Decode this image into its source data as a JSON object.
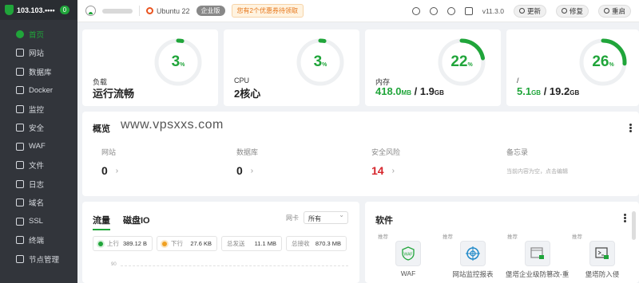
{
  "sidebar": {
    "ip": "103.103.••••",
    "badge": "0",
    "items": [
      {
        "label": "首页",
        "icon": "home-icon",
        "active": true
      },
      {
        "label": "网站",
        "icon": "globe-icon"
      },
      {
        "label": "数据库",
        "icon": "database-icon"
      },
      {
        "label": "Docker",
        "icon": "docker-icon"
      },
      {
        "label": "监控",
        "icon": "monitor-icon"
      },
      {
        "label": "安全",
        "icon": "shield-icon"
      },
      {
        "label": "WAF",
        "icon": "waf-icon"
      },
      {
        "label": "文件",
        "icon": "folder-icon"
      },
      {
        "label": "日志",
        "icon": "log-icon"
      },
      {
        "label": "域名",
        "icon": "domain-icon"
      },
      {
        "label": "SSL",
        "icon": "ssl-icon"
      },
      {
        "label": "终端",
        "icon": "terminal-icon"
      },
      {
        "label": "节点管理",
        "icon": "node-icon"
      }
    ]
  },
  "header": {
    "os": "Ubuntu 22",
    "edition": "企业版",
    "promo": "您有2个优惠券待领取",
    "version": "v11.3.0",
    "buttons": {
      "update": "更新",
      "repair": "修复",
      "restart": "重启"
    }
  },
  "stats": [
    {
      "label": "负载",
      "value": "运行流畅",
      "percent": 3,
      "unit": "%"
    },
    {
      "label": "CPU",
      "value": "2核心",
      "percent": 3,
      "unit": "%"
    },
    {
      "label": "内存",
      "used": "418.0",
      "used_unit": "MB",
      "total": "1.9",
      "total_unit": "GB",
      "percent": 22,
      "unit": "%"
    },
    {
      "label": "/",
      "used": "5.1",
      "used_unit": "GB",
      "total": "19.2",
      "total_unit": "GB",
      "percent": 26,
      "unit": "%"
    }
  ],
  "overview": {
    "title": "概览",
    "watermark": "www.vpsxxs.com",
    "items": [
      {
        "label": "网站",
        "value": "0"
      },
      {
        "label": "数据库",
        "value": "0"
      },
      {
        "label": "安全风险",
        "value": "14"
      },
      {
        "label": "备忘录",
        "placeholder": "当前内容为空，点击编辑"
      }
    ]
  },
  "traffic": {
    "tabs": [
      "流量",
      "磁盘IO"
    ],
    "nic_label": "网卡",
    "nic_value": "所有",
    "metrics": [
      {
        "label": "上行",
        "value": "389.12 B",
        "color": "#20a53a"
      },
      {
        "label": "下行",
        "value": "27.6 KB",
        "color": "#f0a020"
      },
      {
        "label": "总发送",
        "value": "11.1 MB"
      },
      {
        "label": "总接收",
        "value": "870.3 MB"
      }
    ],
    "y_tick": "90"
  },
  "software": {
    "title": "软件",
    "items": [
      {
        "tag": "推荐",
        "name": "WAF",
        "icon": "waf-icon"
      },
      {
        "tag": "推荐",
        "name": "网站监控报表",
        "icon": "site-monitor-icon"
      },
      {
        "tag": "推荐",
        "name": "堡塔企业级防篡改-重...",
        "icon": "tamper-proof-icon"
      },
      {
        "tag": "推荐",
        "name": "堡塔防入侵",
        "icon": "intrusion-defense-icon"
      }
    ]
  },
  "colors": {
    "accent": "#20a53a",
    "danger": "#d6262c",
    "sidebar": "#32353b"
  }
}
